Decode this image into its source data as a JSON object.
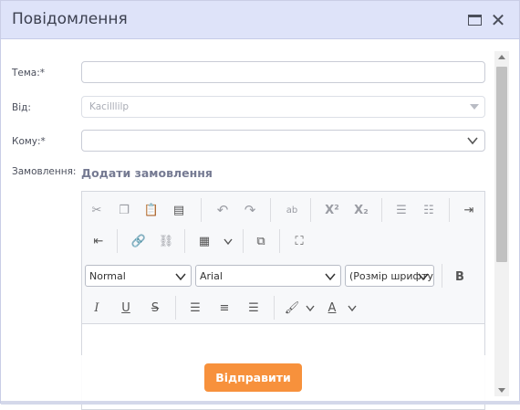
{
  "dialog": {
    "title": "Повідомлення"
  },
  "form": {
    "subject_label": "Тема:*",
    "subject_value": "",
    "from_label": "Від:",
    "from_value": "Kacilllilp",
    "to_label": "Кому:*",
    "to_value": "",
    "order_label": "Замовлення:",
    "add_order_link": "Додати замовлення"
  },
  "editor": {
    "format_select": "Normal",
    "font_select": "Arial",
    "size_select": "(Розмір шрифту)",
    "bold": "B",
    "italic": "I",
    "underline": "U",
    "strike": "S",
    "superscript": "X²",
    "subscript": "X₂",
    "spellcheck": "ab"
  },
  "footer": {
    "send_label": "Відправити"
  },
  "colors": {
    "titlebar": "#dee3f9",
    "accent": "#f7913c",
    "link": "#757a92"
  },
  "icons": [
    "maximize-icon",
    "close-icon",
    "cut-icon",
    "copy-icon",
    "paste-icon",
    "paste-text-icon",
    "undo-icon",
    "redo-icon",
    "spellcheck-icon",
    "superscript-icon",
    "subscript-icon",
    "numbered-list-icon",
    "bulleted-list-icon",
    "indent-icon",
    "outdent-icon",
    "link-icon",
    "unlink-icon",
    "table-icon",
    "preview-icon",
    "fullscreen-icon",
    "bold-icon",
    "italic-icon",
    "underline-icon",
    "strikethrough-icon",
    "align-left-icon",
    "align-center-icon",
    "align-right-icon",
    "bg-color-icon",
    "text-color-icon"
  ]
}
